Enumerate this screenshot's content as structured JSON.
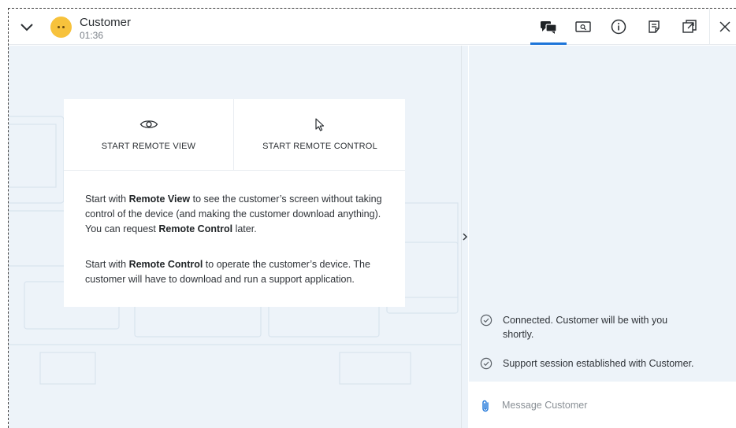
{
  "header": {
    "customer_name": "Customer",
    "elapsed": "01:36",
    "icons": [
      "chevron-down-icon",
      "chat-icon",
      "screenshot-icon",
      "info-icon",
      "notes-icon",
      "popout-icon",
      "close-icon"
    ],
    "accent_color": "#1d75d9",
    "avatar_color": "#f7c23c"
  },
  "session_options": {
    "remote_view_label": "START REMOTE VIEW",
    "remote_control_label": "START REMOTE CONTROL",
    "help1": {
      "a": "Start with ",
      "b": "Remote View",
      "c": " to see the customer’s screen without taking control of the device (and making the customer download anything). You can request ",
      "d": "Remote Control",
      "e": " later."
    },
    "help2": {
      "a": "Start with ",
      "b": "Remote Control",
      "c": " to operate the customer’s device. The customer will have to download and run a support application."
    }
  },
  "chat": {
    "messages": [
      {
        "text": "Connected. Customer will be with you shortly."
      },
      {
        "text": "Support session established with Customer."
      }
    ],
    "input_placeholder": "Message Customer"
  }
}
